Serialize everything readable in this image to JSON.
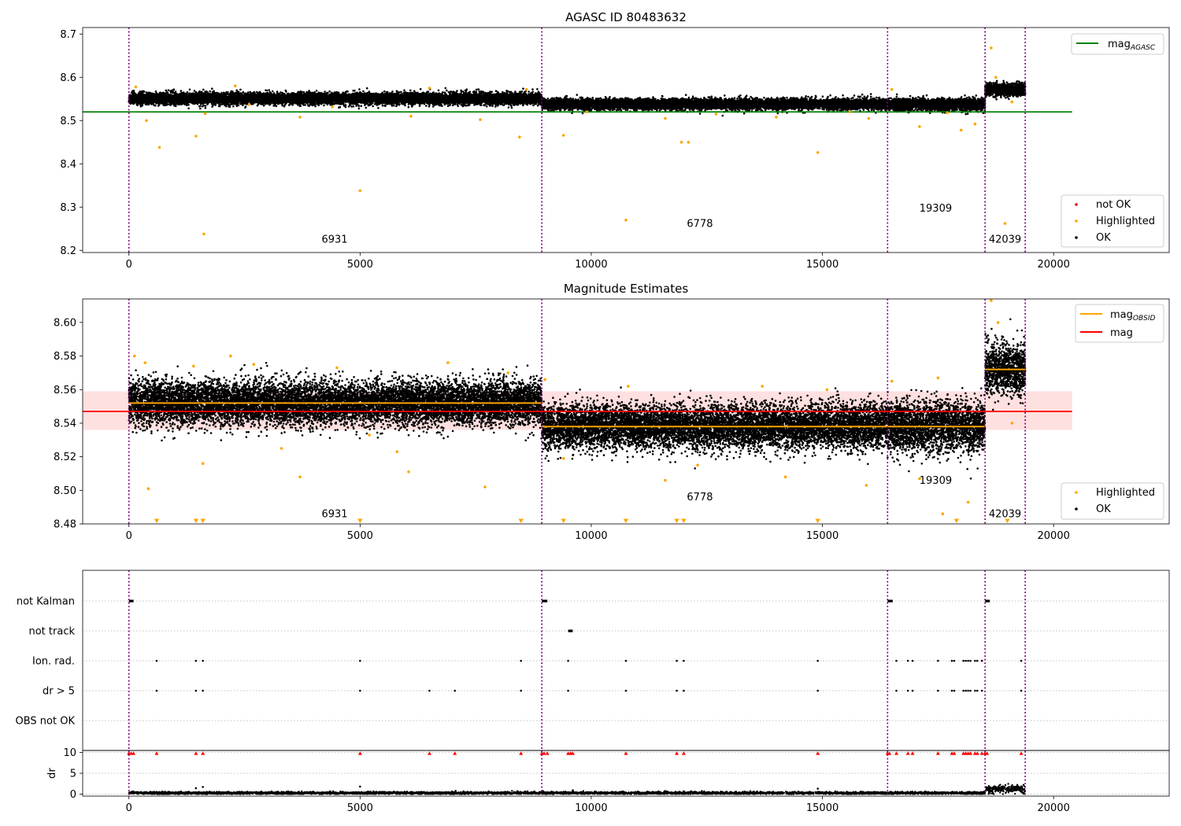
{
  "chart_data": [
    {
      "type": "scatter",
      "title": "AGASC ID 80483632",
      "xlim": [
        -1000,
        22500
      ],
      "ylim": [
        8.195,
        8.715
      ],
      "x_ticks": [
        0,
        5000,
        10000,
        15000,
        20000
      ],
      "y_ticks": [
        8.2,
        8.3,
        8.4,
        8.5,
        8.6,
        8.7
      ],
      "obs_boundaries": [
        0,
        8931,
        16409,
        18518,
        19386
      ],
      "obsid_labels": [
        {
          "text": "6931",
          "x": 4450,
          "y": 8.218
        },
        {
          "text": "6778",
          "x": 12350,
          "y": 8.254
        },
        {
          "text": "19309",
          "x": 17450,
          "y": 8.29
        },
        {
          "text": "42039",
          "x": 18950,
          "y": 8.218
        }
      ],
      "lines": [
        {
          "name": "mag",
          "sub": "AGASC",
          "color": "#008000",
          "y": 8.52,
          "x": [
            -1000,
            20400
          ]
        }
      ],
      "ok_bands": [
        {
          "x": [
            0,
            8931
          ],
          "center": 8.551,
          "spread": 0.0065
        },
        {
          "x": [
            8931,
            16409
          ],
          "center": 8.538,
          "spread": 0.006
        },
        {
          "x": [
            16409,
            18518
          ],
          "center": 8.537,
          "spread": 0.0065
        },
        {
          "x": [
            18518,
            19386
          ],
          "center": 8.572,
          "spread": 0.007
        }
      ],
      "highlighted": [
        [
          150,
          8.578
        ],
        [
          380,
          8.5
        ],
        [
          660,
          8.438
        ],
        [
          1450,
          8.464
        ],
        [
          1620,
          8.238
        ],
        [
          1650,
          8.516
        ],
        [
          2300,
          8.58
        ],
        [
          2600,
          8.537
        ],
        [
          3700,
          8.508
        ],
        [
          4400,
          8.532
        ],
        [
          5000,
          8.338
        ],
        [
          6100,
          8.51
        ],
        [
          6500,
          8.575
        ],
        [
          7600,
          8.502
        ],
        [
          8450,
          8.462
        ],
        [
          8600,
          8.572
        ],
        [
          9400,
          8.466
        ],
        [
          9900,
          8.52
        ],
        [
          10750,
          8.27
        ],
        [
          11600,
          8.505
        ],
        [
          11950,
          8.45
        ],
        [
          12100,
          8.45
        ],
        [
          12700,
          8.515
        ],
        [
          14000,
          8.508
        ],
        [
          14900,
          8.426
        ],
        [
          15600,
          8.52
        ],
        [
          16000,
          8.505
        ],
        [
          16500,
          8.572
        ],
        [
          17100,
          8.486
        ],
        [
          17700,
          8.518
        ],
        [
          18000,
          8.478
        ],
        [
          18300,
          8.492
        ],
        [
          18650,
          8.668
        ],
        [
          18750,
          8.6
        ],
        [
          18950,
          8.262
        ],
        [
          19100,
          8.543
        ]
      ],
      "legends": [
        {
          "position": "upper right",
          "entries": [
            "mag",
            "AGASC"
          ]
        },
        {
          "position": "lower right",
          "entries": [
            "not OK",
            "Highlighted",
            "OK"
          ]
        }
      ]
    },
    {
      "type": "scatter",
      "title": "Magnitude Estimates",
      "xlim": [
        -1000,
        22500
      ],
      "ylim": [
        8.48,
        8.614
      ],
      "x_ticks": [
        0,
        5000,
        10000,
        15000,
        20000
      ],
      "y_ticks": [
        8.48,
        8.5,
        8.52,
        8.54,
        8.56,
        8.58,
        8.6
      ],
      "y_tick_labels": [
        "8.48",
        "8.50",
        "8.52",
        "8.54",
        "8.56",
        "8.58",
        "8.60"
      ],
      "obs_boundaries": [
        0,
        8931,
        16409,
        18518,
        19386
      ],
      "obsid_labels": [
        {
          "text": "6931",
          "x": 4450,
          "y": 8.484
        },
        {
          "text": "6778",
          "x": 12350,
          "y": 8.494
        },
        {
          "text": "19309",
          "x": 17450,
          "y": 8.504
        },
        {
          "text": "42039",
          "x": 18950,
          "y": 8.484
        }
      ],
      "mag_line": {
        "name": "mag",
        "color": "#ff0000",
        "y": 8.547,
        "band": [
          8.536,
          8.559
        ],
        "x": [
          -1000,
          20400
        ]
      },
      "obsid_mags": [
        {
          "x": [
            0,
            8931
          ],
          "y": 8.552
        },
        {
          "x": [
            8931,
            18518
          ],
          "y": 8.538
        },
        {
          "x": [
            18518,
            19386
          ],
          "y": 8.572
        }
      ],
      "ok_bands": [
        {
          "x": [
            0,
            8931
          ],
          "center": 8.552,
          "spread": 0.0065
        },
        {
          "x": [
            8931,
            16409
          ],
          "center": 8.538,
          "spread": 0.0065
        },
        {
          "x": [
            16409,
            18518
          ],
          "center": 8.538,
          "spread": 0.0075
        },
        {
          "x": [
            18518,
            19386
          ],
          "center": 8.572,
          "spread": 0.0075
        }
      ],
      "highlighted": [
        [
          120,
          8.58
        ],
        [
          350,
          8.576
        ],
        [
          420,
          8.501
        ],
        [
          1400,
          8.574
        ],
        [
          1600,
          8.516
        ],
        [
          2200,
          8.58
        ],
        [
          2700,
          8.575
        ],
        [
          3300,
          8.525
        ],
        [
          3700,
          8.508
        ],
        [
          4500,
          8.573
        ],
        [
          5200,
          8.533
        ],
        [
          5800,
          8.523
        ],
        [
          6050,
          8.511
        ],
        [
          6900,
          8.576
        ],
        [
          7700,
          8.502
        ],
        [
          8200,
          8.57
        ],
        [
          9000,
          8.566
        ],
        [
          9400,
          8.519
        ],
        [
          10800,
          8.562
        ],
        [
          11600,
          8.506
        ],
        [
          12300,
          8.515
        ],
        [
          13700,
          8.562
        ],
        [
          14200,
          8.508
        ],
        [
          15100,
          8.56
        ],
        [
          15950,
          8.503
        ],
        [
          16500,
          8.565
        ],
        [
          17100,
          8.507
        ],
        [
          17500,
          8.567
        ],
        [
          17600,
          8.486
        ],
        [
          18150,
          8.493
        ],
        [
          18650,
          8.613
        ],
        [
          18800,
          8.6
        ],
        [
          19100,
          8.54
        ]
      ],
      "below_range_markers": [
        600,
        1450,
        1600,
        5000,
        8480,
        9400,
        10750,
        11850,
        12000,
        14900,
        17900,
        19000
      ],
      "legends": [
        {
          "position": "upper right",
          "entries": [
            "mag",
            "OBSID",
            "mag"
          ]
        },
        {
          "position": "lower right",
          "entries": [
            "Highlighted",
            "OK"
          ]
        }
      ]
    },
    {
      "type": "scatter",
      "title": "",
      "xlim": [
        -1000,
        22500
      ],
      "x_ticks": [
        0,
        5000,
        10000,
        15000,
        20000
      ],
      "obs_boundaries": [
        0,
        8931,
        16409,
        18518,
        19386
      ],
      "flag_labels": [
        "not Kalman",
        "not track",
        "Ion. rad.",
        "dr > 5",
        "OBS not OK"
      ],
      "flags": {
        "not Kalman": [
          [
            0,
            100
          ],
          [
            8931,
            9050
          ],
          [
            16409,
            16520
          ],
          [
            18518,
            18620
          ]
        ],
        "not track": [
          [
            9500,
            9600
          ]
        ],
        "Ion. rad.": [
          600,
          1450,
          1600,
          5000,
          8480,
          9500,
          10750,
          11850,
          12000,
          14900,
          16600,
          16850,
          16950,
          17500,
          17800,
          17850,
          18050,
          18100,
          18150,
          18200,
          18300,
          18350,
          18450,
          19300
        ],
        "dr > 5": [
          600,
          1450,
          1600,
          5000,
          6500,
          7050,
          8480,
          9500,
          10750,
          11850,
          12000,
          14900,
          16600,
          16850,
          16950,
          17500,
          17800,
          17850,
          18050,
          18100,
          18150,
          18200,
          18300,
          18350,
          18450,
          19300
        ],
        "OBS not OK": []
      },
      "dr_axis": {
        "ylabel": "dr",
        "ylim": [
          -0.5,
          10.5
        ],
        "y_ticks": [
          0,
          5,
          10
        ]
      },
      "dr_clipped": [
        0,
        50,
        100,
        600,
        1450,
        1600,
        5000,
        6500,
        7050,
        8480,
        8931,
        8980,
        9050,
        9500,
        9550,
        9600,
        10750,
        11850,
        12000,
        14900,
        16409,
        16450,
        16600,
        16850,
        16950,
        17500,
        17800,
        17850,
        18050,
        18100,
        18150,
        18200,
        18300,
        18350,
        18450,
        18518,
        18560,
        19300
      ],
      "dr_bands": [
        {
          "x": [
            0,
            18518
          ],
          "center": 0.25,
          "spread": 0.15
        },
        {
          "x": [
            18518,
            19386
          ],
          "center": 1.2,
          "spread": 0.45
        }
      ],
      "dr_extra": [
        [
          1450,
          1.4
        ],
        [
          1600,
          1.7
        ],
        [
          5000,
          1.8
        ],
        [
          14900,
          1.3
        ],
        [
          9600,
          0.9
        ]
      ]
    }
  ]
}
